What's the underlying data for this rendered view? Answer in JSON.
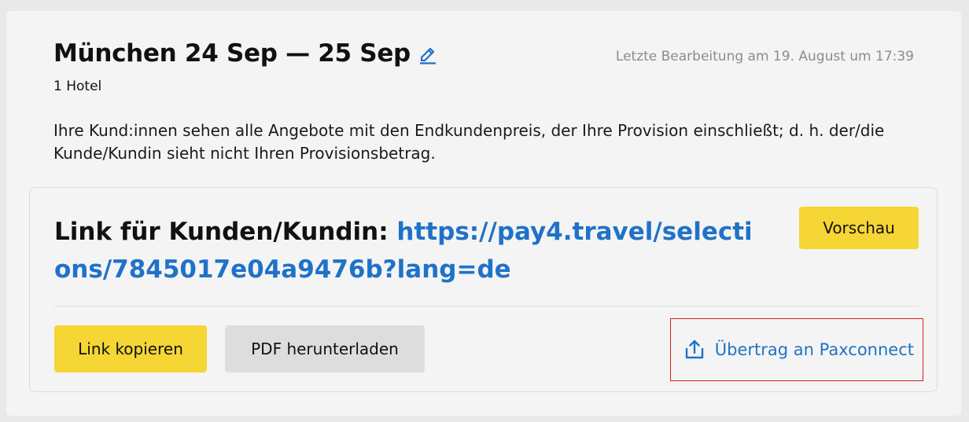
{
  "header": {
    "title": "München 24 Sep — 25 Sep",
    "last_edit": "Letzte Bearbeitung am 19. August um 17:39",
    "hotel_count": "1 Hotel"
  },
  "info_text": "Ihre Kund:innen sehen alle Angebote mit den Endkundenpreis, der Ihre Provision einschließt; d. h. der/die Kunde/Kundin sieht nicht Ihren Provisionsbetrag.",
  "link_section": {
    "label": "Link für Kunden/Kundin: ",
    "url": "https://pay4.travel/selections/7845017e04a9476b?lang=de",
    "preview_button": "Vorschau",
    "copy_button": "Link kopieren",
    "pdf_button": "PDF herunterladen",
    "transfer_link": "Übertrag an Paxconnect"
  },
  "icons": {
    "edit": "pencil-icon",
    "transfer": "upload-icon"
  },
  "colors": {
    "accent_blue": "#1f72c8",
    "button_yellow": "#f5d634",
    "button_gray": "#dddddd",
    "highlight_red": "#d21f1f"
  }
}
